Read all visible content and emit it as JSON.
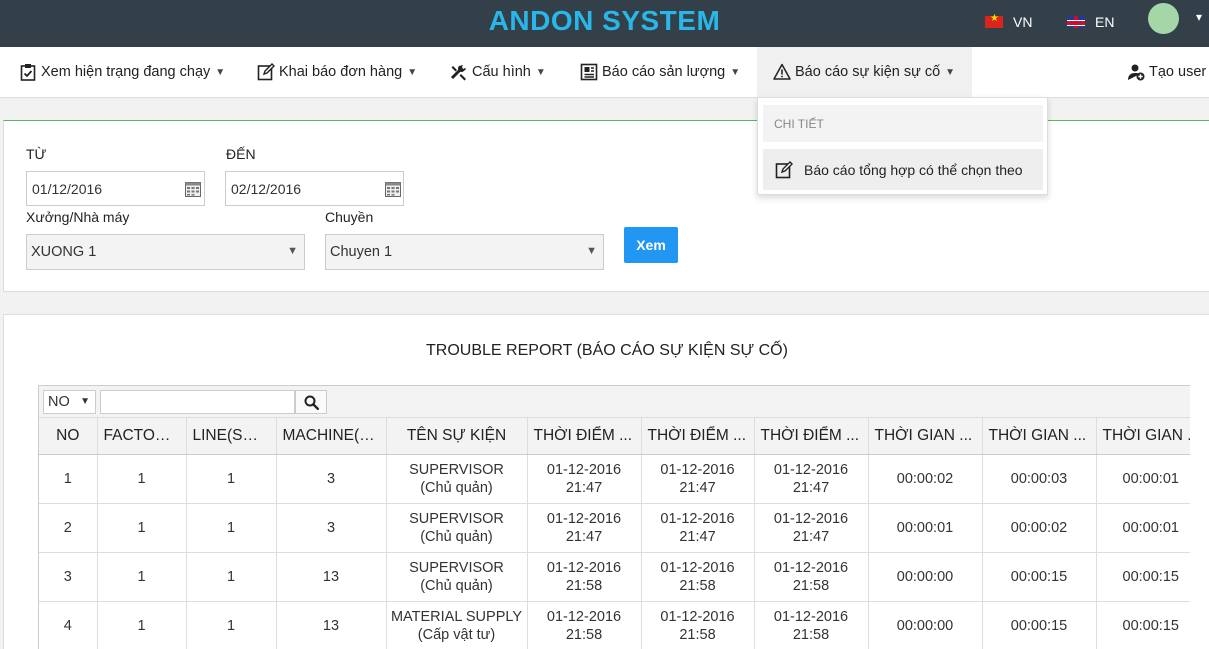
{
  "app": {
    "title": "ANDON SYSTEM"
  },
  "languages": {
    "vn": "VN",
    "en": "EN"
  },
  "nav": {
    "items": [
      {
        "label": "Xem hiện trạng đang chạy"
      },
      {
        "label": "Khai báo đơn hàng"
      },
      {
        "label": "Cấu hình"
      },
      {
        "label": "Báo cáo sản lượng"
      },
      {
        "label": "Báo cáo sự kiện sự cố"
      }
    ],
    "create_user": "Tạo user",
    "dropdown": {
      "header": "CHI TIẾT",
      "item": "Báo cáo tổng hợp có thể chọn theo"
    }
  },
  "filter": {
    "from_label": "TỪ",
    "to_label": "ĐẾN",
    "from_value": "01/12/2016",
    "to_value": "02/12/2016",
    "factory_label": "Xưởng/Nhà máy",
    "factory_value": "XUONG 1",
    "line_label": "Chuyền",
    "line_value": "Chuyen 1",
    "submit_label": "Xem"
  },
  "report": {
    "title": "TROUBLE REPORT (BÁO CÁO SỰ KIỆN SỰ CỐ)",
    "column_select": "NO",
    "search_value": "",
    "columns": [
      "NO",
      "FACTORY(...",
      "LINE(SỐ ...",
      "MACHINE(S...",
      "TÊN SỰ KIỆN",
      "THỜI ĐIỂM ...",
      "THỜI ĐIỂM ...",
      "THỜI ĐIỂM ...",
      "THỜI GIAN ...",
      "THỜI GIAN ...",
      "THỜI GIAN ..."
    ],
    "rows": [
      {
        "no": "1",
        "factory": "1",
        "line": "1",
        "machine": "3",
        "event": "SUPERVISOR",
        "event_vi": "(Chủ quản)",
        "t1_date": "01-12-2016",
        "t1_time": "21:47",
        "t2_date": "01-12-2016",
        "t2_time": "21:47",
        "t3_date": "01-12-2016",
        "t3_time": "21:47",
        "d1": "00:00:02",
        "d2": "00:00:03",
        "d3": "00:00:01"
      },
      {
        "no": "2",
        "factory": "1",
        "line": "1",
        "machine": "3",
        "event": "SUPERVISOR",
        "event_vi": "(Chủ quản)",
        "t1_date": "01-12-2016",
        "t1_time": "21:47",
        "t2_date": "01-12-2016",
        "t2_time": "21:47",
        "t3_date": "01-12-2016",
        "t3_time": "21:47",
        "d1": "00:00:01",
        "d2": "00:00:02",
        "d3": "00:00:01"
      },
      {
        "no": "3",
        "factory": "1",
        "line": "1",
        "machine": "13",
        "event": "SUPERVISOR",
        "event_vi": "(Chủ quản)",
        "t1_date": "01-12-2016",
        "t1_time": "21:58",
        "t2_date": "01-12-2016",
        "t2_time": "21:58",
        "t3_date": "01-12-2016",
        "t3_time": "21:58",
        "d1": "00:00:00",
        "d2": "00:00:15",
        "d3": "00:00:15"
      },
      {
        "no": "4",
        "factory": "1",
        "line": "1",
        "machine": "13",
        "event": "MATERIAL SUPPLY",
        "event_vi": "(Cấp vật tư)",
        "t1_date": "01-12-2016",
        "t1_time": "21:58",
        "t2_date": "01-12-2016",
        "t2_time": "21:58",
        "t3_date": "01-12-2016",
        "t3_time": "21:58",
        "d1": "00:00:00",
        "d2": "00:00:15",
        "d3": "00:00:15"
      }
    ]
  },
  "colors": {
    "topbar": "#334049",
    "brand": "#29b6e8",
    "primary_button": "#2196f3",
    "accent_line": "#5cb85c"
  }
}
